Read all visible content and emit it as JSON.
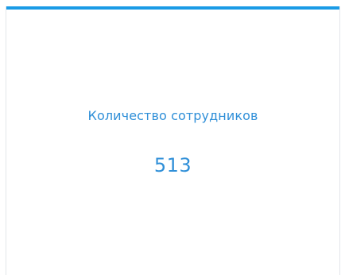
{
  "widget": {
    "title": "Количество сотрудников",
    "value": "513",
    "accent_color": "#1a9be6",
    "text_color": "#2f8fd8"
  }
}
